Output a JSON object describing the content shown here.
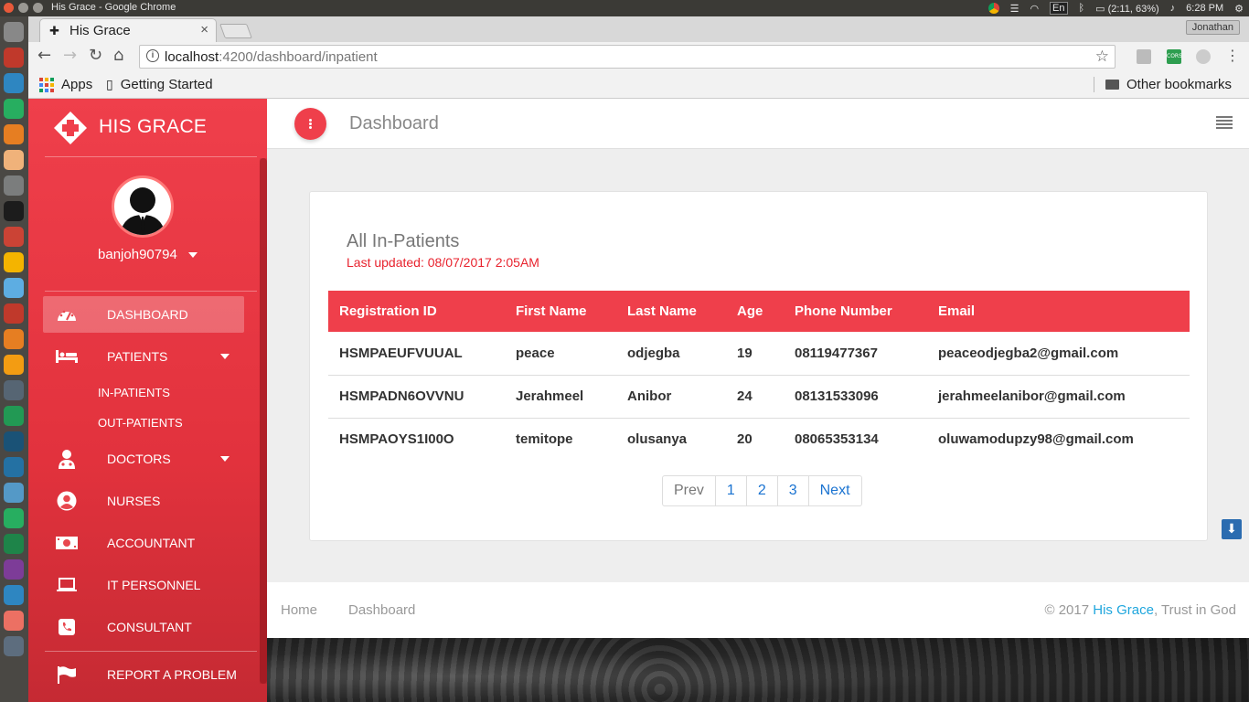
{
  "os": {
    "window_title": "His Grace - Google Chrome",
    "battery": "(2:11, 63%)",
    "clock": "6:28 PM",
    "keyboard": "En"
  },
  "browser": {
    "tab_title": "His Grace",
    "url_host": "localhost",
    "url_path": ":4200/dashboard/inpatient",
    "profile": "Jonathan",
    "bookmarks": {
      "apps": "Apps",
      "getting_started": "Getting Started",
      "other": "Other bookmarks"
    },
    "extension_cors_label": "CORS"
  },
  "sidebar": {
    "brand": "HIS GRACE",
    "username": "banjoh90794",
    "items": [
      {
        "label": "DASHBOARD",
        "icon": "dashboard-icon"
      },
      {
        "label": "PATIENTS",
        "icon": "bed-icon"
      },
      {
        "label": "DOCTORS",
        "icon": "doctor-icon"
      },
      {
        "label": "NURSES",
        "icon": "nurse-icon"
      },
      {
        "label": "ACCOUNTANT",
        "icon": "money-icon"
      },
      {
        "label": "IT PERSONNEL",
        "icon": "laptop-icon"
      },
      {
        "label": "CONSULTANT",
        "icon": "phone-icon"
      },
      {
        "label": "REPORT A PROBLEM",
        "icon": "flag-icon"
      }
    ],
    "patients_sub": [
      "IN-PATIENTS",
      "OUT-PATIENTS"
    ]
  },
  "topbar": {
    "title": "Dashboard"
  },
  "card": {
    "title": "All In-Patients",
    "last_updated": "Last updated: 08/07/2017 2:05AM",
    "columns": [
      "Registration ID",
      "First Name",
      "Last Name",
      "Age",
      "Phone Number",
      "Email"
    ],
    "rows": [
      [
        "HSMPAEUFVUUAL",
        "peace",
        "odjegba",
        "19",
        "08119477367",
        "peaceodjegba2@gmail.com"
      ],
      [
        "HSMPADN6OVVNU",
        "Jerahmeel",
        "Anibor",
        "24",
        "08131533096",
        "jerahmeelanibor@gmail.com"
      ],
      [
        "HSMPAOYS1I00O",
        "temitope",
        "olusanya",
        "20",
        "08065353134",
        "oluwamodupzy98@gmail.com"
      ]
    ],
    "pager": [
      "Prev",
      "1",
      "2",
      "3",
      "Next"
    ]
  },
  "footer": {
    "home": "Home",
    "dashboard": "Dashboard",
    "copy_prefix": "© 2017 ",
    "copy_brand": "His Grace",
    "copy_suffix": ", Trust in God"
  },
  "colors": {
    "accent": "#ef3f4b",
    "link": "#1a73d1"
  }
}
